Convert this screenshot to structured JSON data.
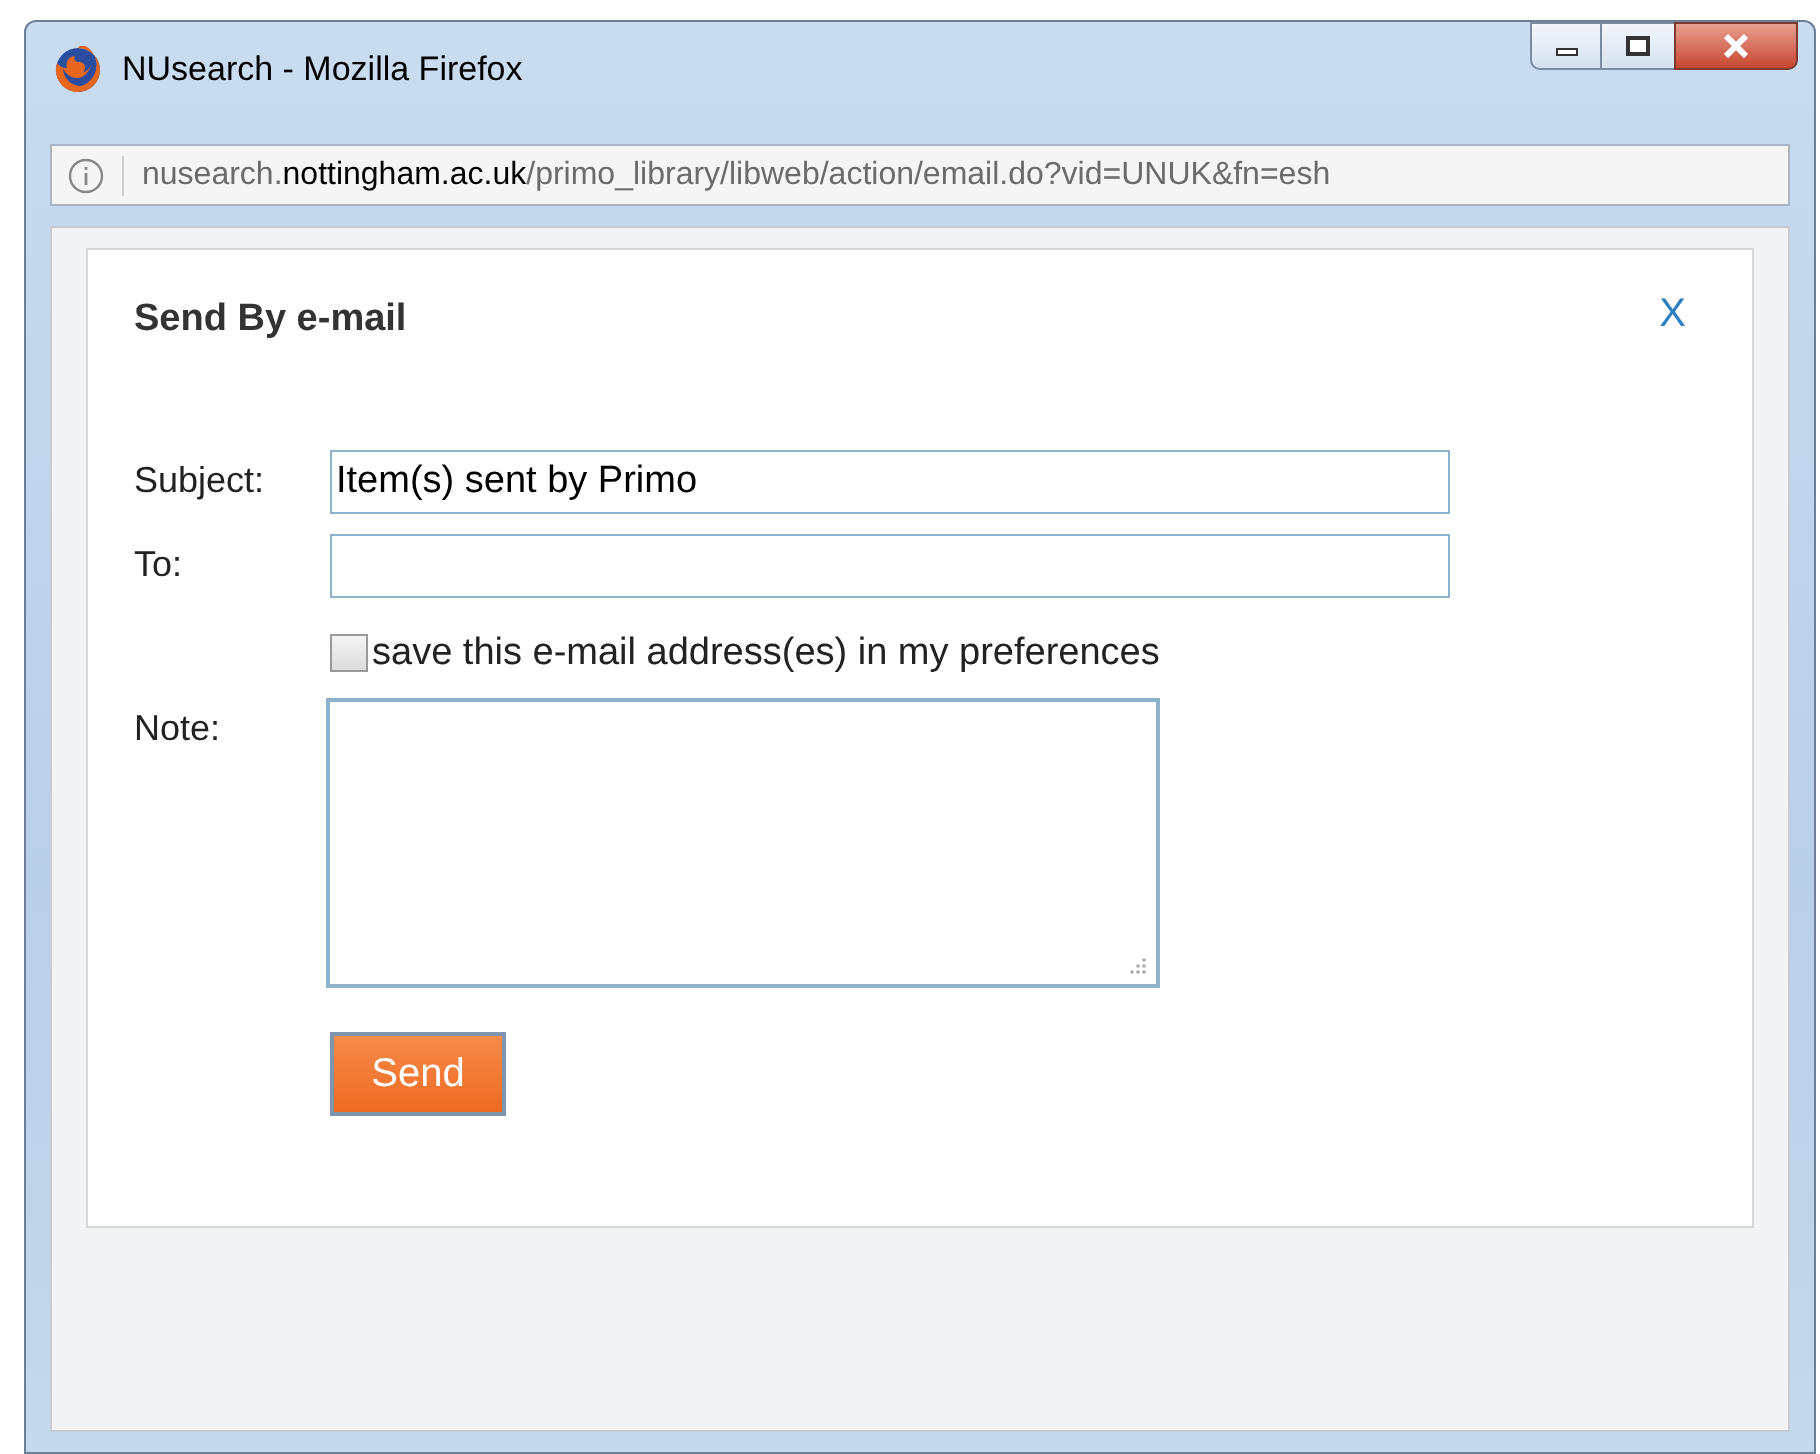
{
  "window": {
    "title": "NUsearch - Mozilla Firefox"
  },
  "address_bar": {
    "url": "nusearch.**nottingham.ac.uk**/primo_library/libweb/action/email.do?vid=UNUK&fn=esh"
  },
  "dialog": {
    "title": "Send By e-mail",
    "close": "X",
    "fields": [
      {
        "label": "Subject:",
        "value": "Item(s) sent by Primo"
      },
      {
        "label": "To:"
      }
    ],
    "save_option": {
      "label": "save this e-mail address(es) in my preferences",
      "checked": false
    },
    "note": {
      "label": "Note:"
    },
    "send_button": "Send"
  }
}
